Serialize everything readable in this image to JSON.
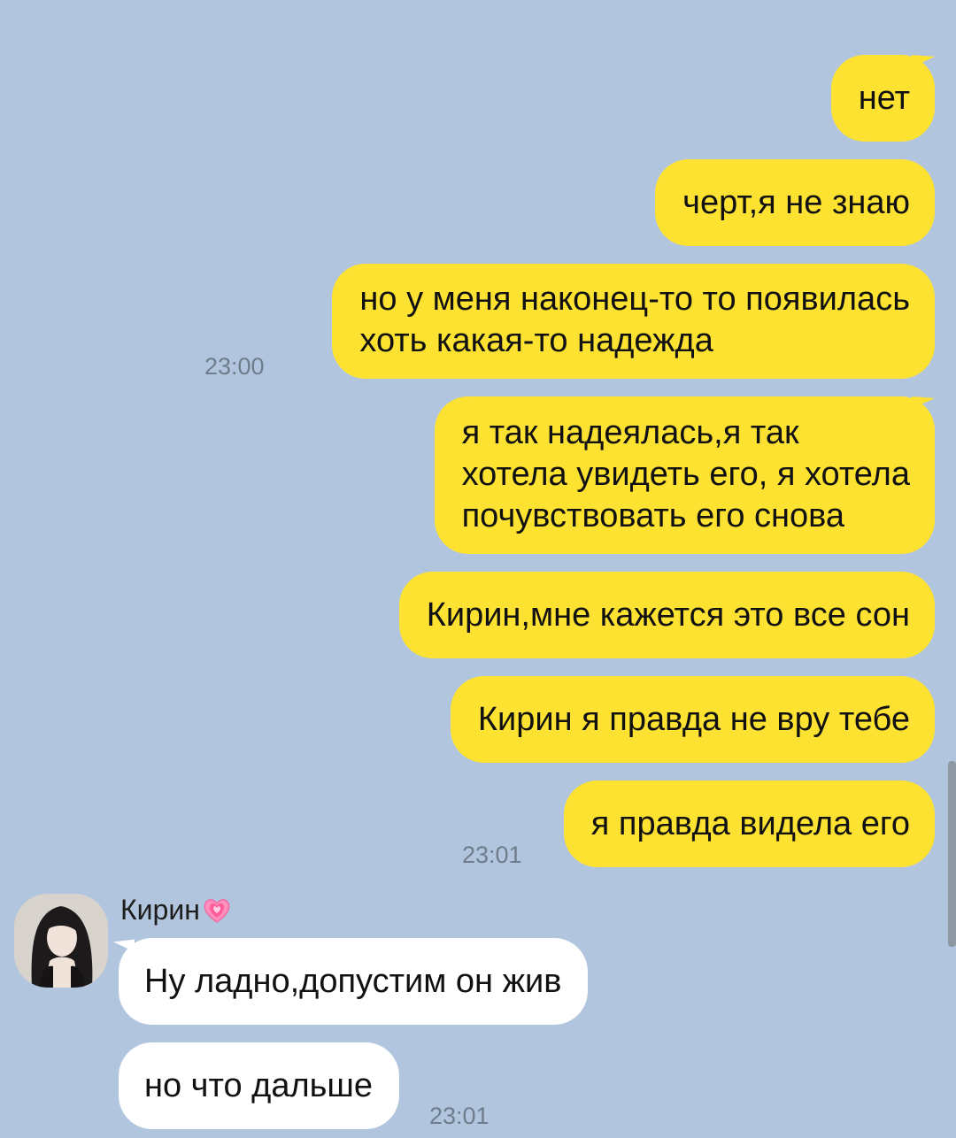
{
  "chat": {
    "outgoing": [
      {
        "text": "нет"
      },
      {
        "text": "черт,я не знаю"
      },
      {
        "lines": [
          "но у меня наконец-то то появилась",
          "хоть какая-то надежда"
        ],
        "time": "23:00"
      },
      {
        "lines": [
          "я так надеялась,я так",
          "хотела увидеть его, я хотела",
          "почувствовать его снова"
        ]
      },
      {
        "text": "Кирин,мне кажется это все сон"
      },
      {
        "text": "Кирин я правда не вру тебе"
      },
      {
        "text": "я правда видела его",
        "time": "23:01"
      }
    ],
    "incoming": {
      "sender_name": "Кирин",
      "sender_emoji": "growing-heart-icon",
      "messages": [
        {
          "text": "Ну ладно,допустим он жив"
        },
        {
          "text": "но что дальше",
          "time": "23:01"
        }
      ]
    }
  },
  "colors": {
    "background": "#b1c6de",
    "outgoing_bubble": "#fee231",
    "incoming_bubble": "#ffffff",
    "timestamp": "#6f7c8c",
    "heart": "#ff6fa8"
  }
}
